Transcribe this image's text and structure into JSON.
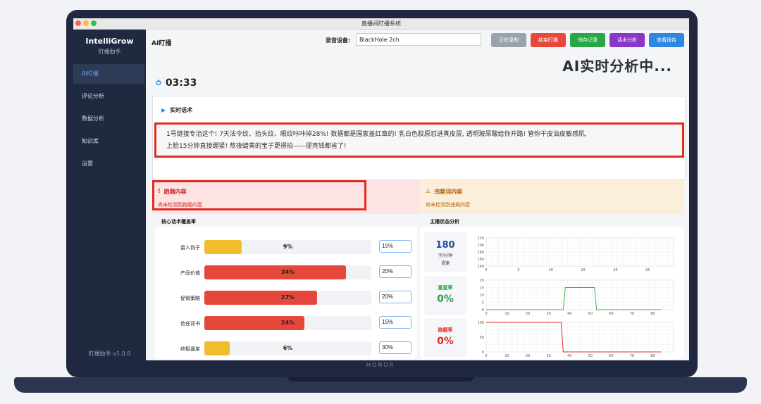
{
  "window": {
    "title": "直播间盯播系统"
  },
  "brand": {
    "name": "IntelliGrow",
    "subtitle": "盯播助手"
  },
  "sidebar": {
    "items": [
      {
        "label": "AI盯播",
        "active": true
      },
      {
        "label": "评论分析"
      },
      {
        "label": "数据分析"
      },
      {
        "label": "知识库"
      },
      {
        "label": "设置"
      }
    ],
    "version": "盯播助手 v1.0.0"
  },
  "header": {
    "page_title": "AI盯播",
    "device_label": "录音设备:",
    "device_value": "BlackHole 2ch",
    "buttons": {
      "status": "正在录制",
      "stop": "结束盯播",
      "save": "保存记录",
      "script": "话术分析",
      "report": "查看报告"
    },
    "ai_status": "AI实时分析中..."
  },
  "timer": {
    "value": "03:33"
  },
  "script": {
    "title": "实时话术",
    "line1": "1号链接专治这个!  7天法令纹、抬头纹、眼纹咔咔掉28%!  数据都是国家盖红章的!  乳白色胶原怼进真皮层,  透明玻尿酸给你开路!  管你干皮油皮敏感肌,",
    "line2": "上脸15分钟直接绷紧!  熬夜蜡黄的宝子更得拍——提亮钱都省了!"
  },
  "alerts": {
    "offtopic": {
      "title": "跑题内容",
      "message": "尚未检测到跑题内容"
    },
    "violation": {
      "title": "违禁词内容",
      "message": "尚未检测到违规内容"
    }
  },
  "coverage": {
    "title": "核心话术覆盖率",
    "rows": [
      {
        "label": "留人钩子",
        "value": 9,
        "pct": "9%",
        "target": "15%",
        "color": "#f0be2c"
      },
      {
        "label": "产品价值",
        "value": 34,
        "pct": "34%",
        "target": "20%",
        "color": "#e5483b"
      },
      {
        "label": "促销策略",
        "value": 27,
        "pct": "27%",
        "target": "20%",
        "color": "#e5483b"
      },
      {
        "label": "信任背书",
        "value": 24,
        "pct": "24%",
        "target": "15%",
        "color": "#e5483b"
      },
      {
        "label": "终极逼单",
        "value": 6,
        "pct": "6%",
        "target": "30%",
        "color": "#f0be2c"
      }
    ]
  },
  "status": {
    "title": "主播状态分析",
    "speed": {
      "value": "180",
      "unit": "字/分钟",
      "label": "语速"
    },
    "repeat": {
      "label": "重复率",
      "value": "0%"
    },
    "offtopic": {
      "label": "跑题率",
      "value": "0%"
    }
  },
  "chart_data": [
    {
      "type": "line",
      "name": "speed",
      "ylim": [
        140,
        220
      ],
      "yticks": [
        "220",
        "200",
        "180",
        "160",
        "140"
      ],
      "xticks": [
        "0",
        "5",
        "10",
        "15",
        "20",
        "25"
      ],
      "xlim": [
        0,
        29
      ],
      "color": "#2f86e0",
      "x": [],
      "y": []
    },
    {
      "type": "line",
      "name": "repeat-rate",
      "ylim": [
        0,
        20
      ],
      "yticks": [
        "20",
        "15",
        "10",
        "5",
        "0"
      ],
      "xticks": [
        "0",
        "10",
        "20",
        "30",
        "40",
        "50",
        "60",
        "70",
        "80"
      ],
      "xlim": [
        0,
        90
      ],
      "color": "#3cb043",
      "x": [
        0,
        37,
        38,
        52,
        53,
        84
      ],
      "y": [
        0,
        0,
        15,
        15,
        0,
        0
      ]
    },
    {
      "type": "line",
      "name": "offtopic-rate",
      "ylim": [
        0,
        100
      ],
      "yticks": [
        "100",
        "50",
        "0"
      ],
      "xticks": [
        "0",
        "10",
        "20",
        "30",
        "40",
        "50",
        "60",
        "70",
        "80"
      ],
      "xlim": [
        0,
        90
      ],
      "color": "#e02c1f",
      "x": [
        0,
        36,
        37,
        84
      ],
      "y": [
        100,
        100,
        0,
        0
      ]
    }
  ],
  "device": {
    "brand": "HONOR"
  }
}
